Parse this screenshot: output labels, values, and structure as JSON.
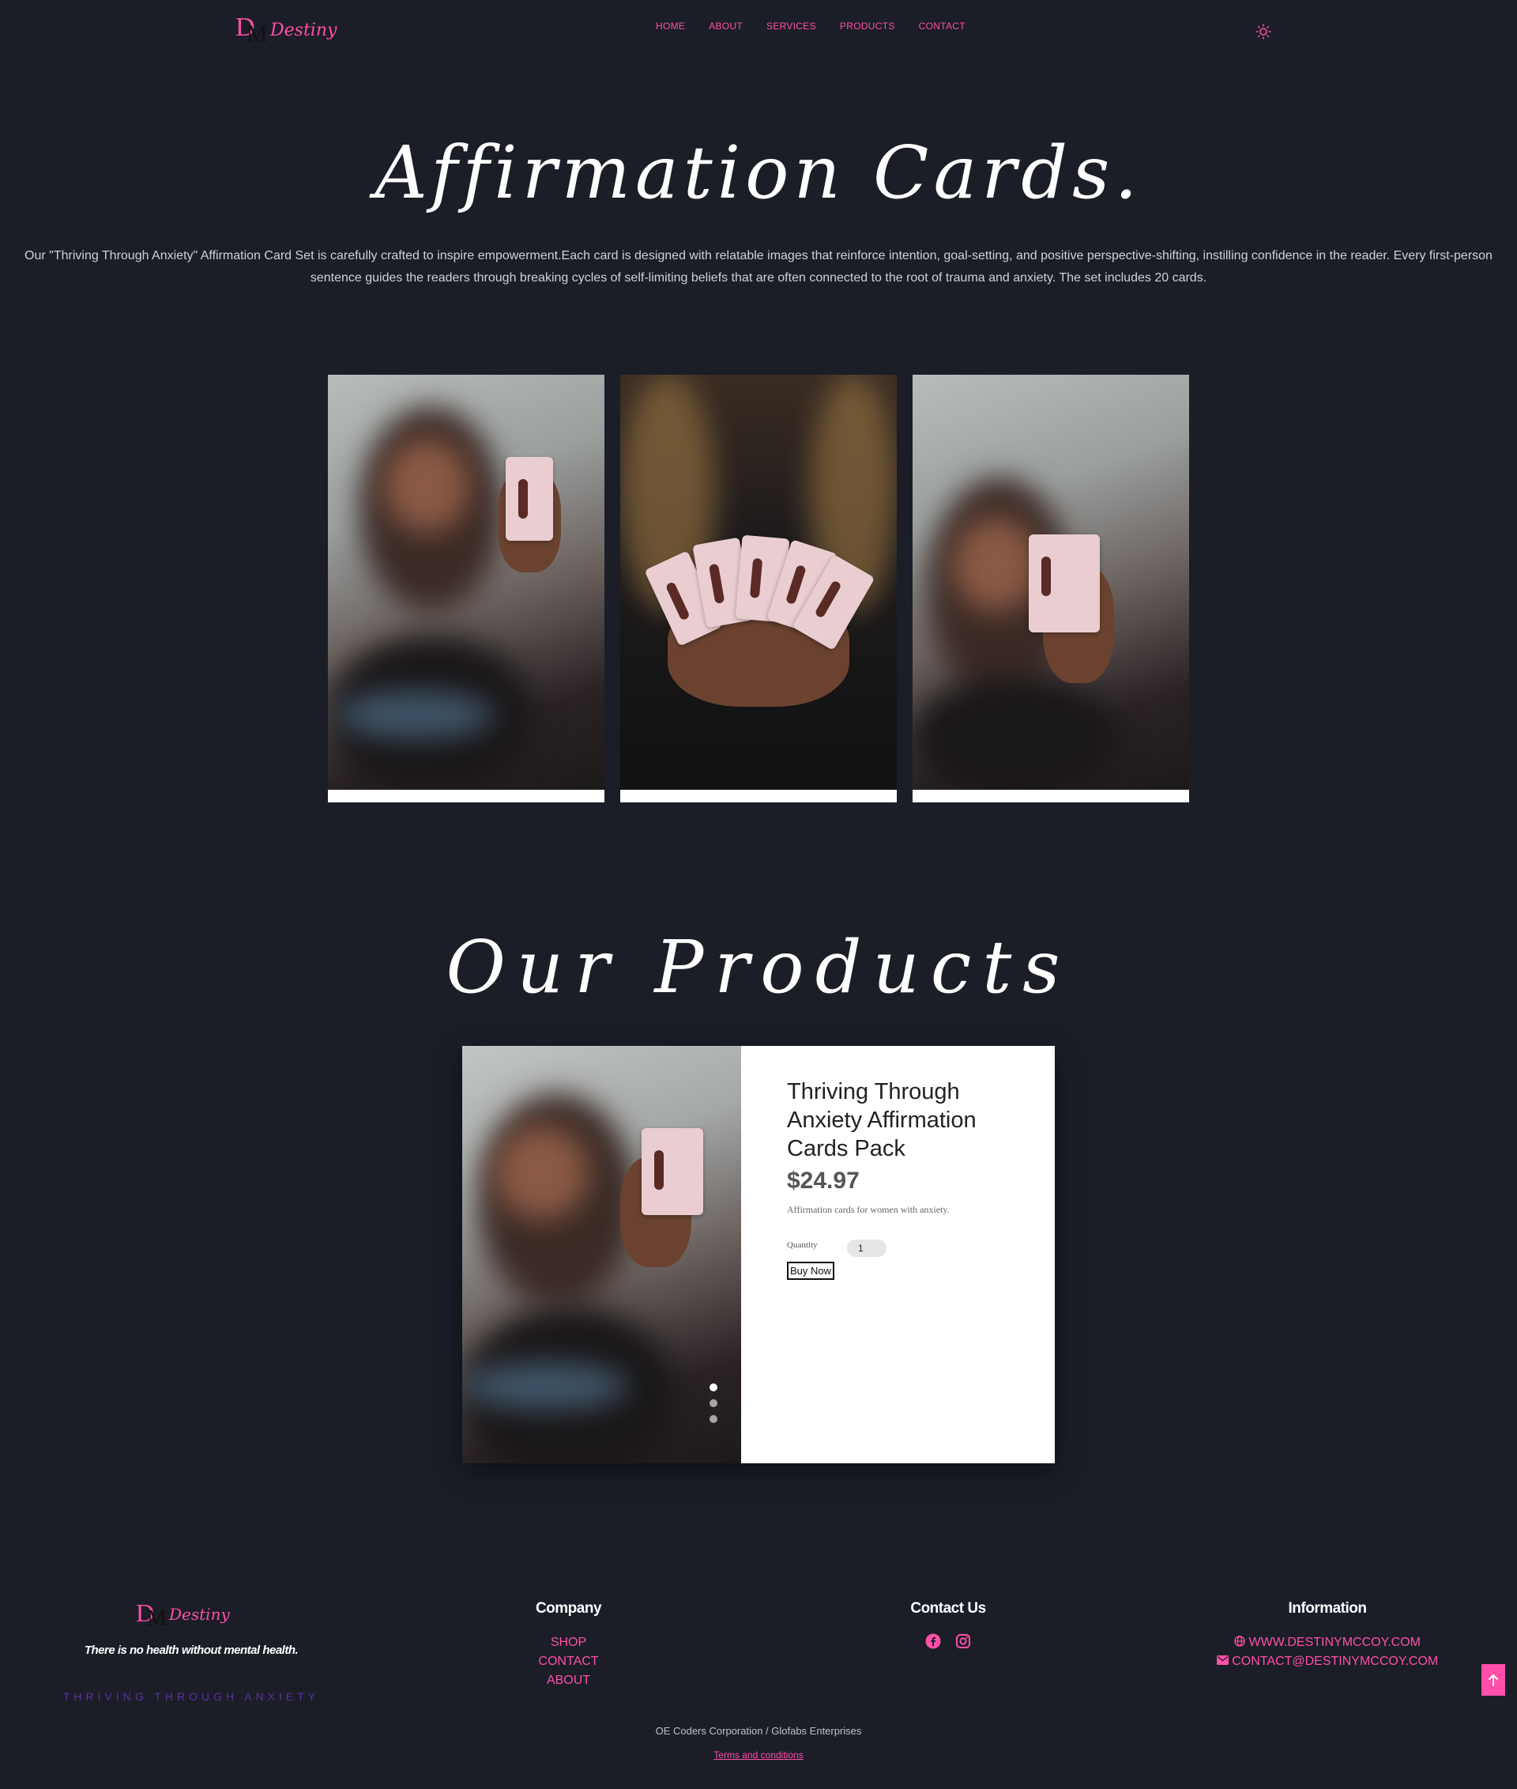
{
  "brand": {
    "logo_letters": "D",
    "logo_letters2": "M",
    "logo_script": "Destiny"
  },
  "nav": {
    "items": [
      "HOME",
      "ABOUT",
      "SERVICES",
      "PRODUCTS",
      "CONTACT"
    ]
  },
  "hero": {
    "title": "Affirmation Cards.",
    "description": "Our \"Thriving Through Anxiety\" Affirmation Card Set is carefully crafted to inspire empowerment.Each card is designed with relatable images that reinforce intention, goal-setting, and positive perspective-shifting, instilling confidence in the reader. Every first-person sentence guides the readers through breaking cycles of self-limiting beliefs that are often connected to the root of trauma and anxiety. The set includes 20 cards."
  },
  "products": {
    "title": "Our Products",
    "item": {
      "name": "Thriving Through Anxiety Affirmation Cards Pack",
      "price": "$24.97",
      "description": "Affirmation cards for women with anxiety.",
      "quantity_label": "Quantity",
      "quantity_value": "1",
      "buy_label": "Buy Now"
    }
  },
  "footer": {
    "tagline": "There is no health without mental health.",
    "brand_line": "THRIVING THROUGH ANXIETY",
    "company": {
      "heading": "Company",
      "links": [
        "SHOP",
        "CONTACT",
        "ABOUT"
      ]
    },
    "contact": {
      "heading": "Contact Us"
    },
    "information": {
      "heading": "Information",
      "website": "WWW.DESTINYMCCOY.COM",
      "email": "CONTACT@DESTINYMCCOY.COM"
    },
    "credits": "OE Coders Corporation / Glofabs Enterprises",
    "terms": "Terms and conditions"
  },
  "colors": {
    "accent": "#ff4fa8",
    "background": "#1b1e27",
    "brand_purple": "#5b2fa1"
  }
}
